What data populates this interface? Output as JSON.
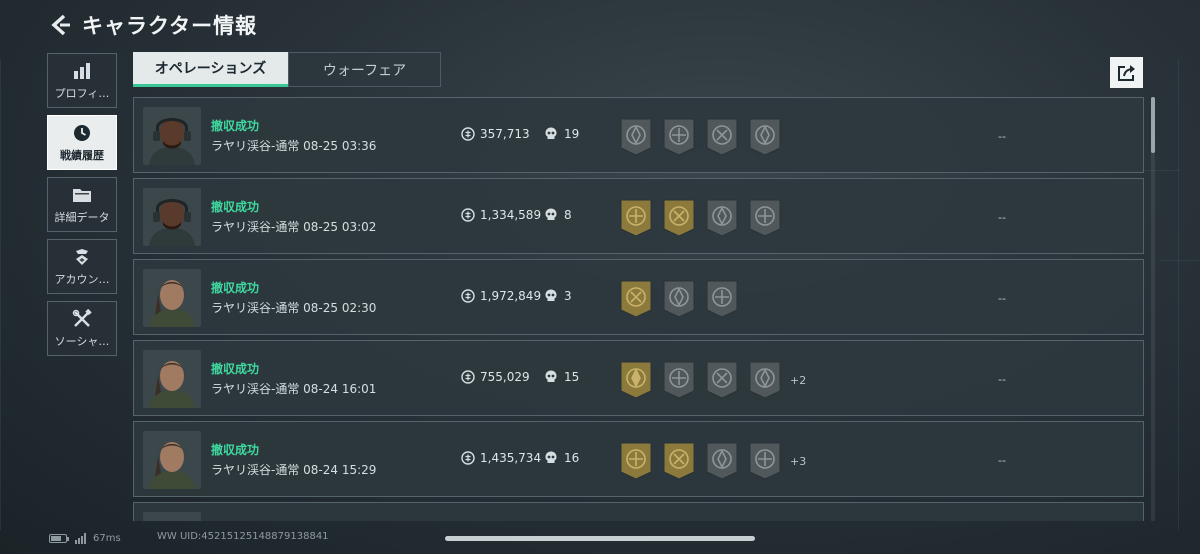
{
  "header": {
    "title": "キャラクター情報"
  },
  "sidebar": {
    "items": [
      {
        "label": "プロフィ…",
        "icon": "bar-chart-icon",
        "active": false
      },
      {
        "label": "戦績履歴",
        "icon": "history-clock-icon",
        "active": true
      },
      {
        "label": "詳細データ",
        "icon": "folder-icon",
        "active": false
      },
      {
        "label": "アカウン…",
        "icon": "account-badge-icon",
        "active": false
      },
      {
        "label": "ソーシャ…",
        "icon": "tools-icon",
        "active": false
      }
    ]
  },
  "tabs": [
    {
      "label": "オペレーションズ",
      "active": true
    },
    {
      "label": "ウォーフェア",
      "active": false
    }
  ],
  "share": {
    "icon": "share-export-icon"
  },
  "records": [
    {
      "result": "撤収成功",
      "detail": "ラヤリ渓谷-通常 08-25 03:36",
      "value": "357,713",
      "kills": "19",
      "more": "",
      "dash": "--",
      "avatar": "operator-male",
      "badges": [
        "grey",
        "grey",
        "grey",
        "grey"
      ]
    },
    {
      "result": "撤収成功",
      "detail": "ラヤリ渓谷-通常 08-25 03:02",
      "value": "1,334,589",
      "kills": "8",
      "more": "",
      "dash": "--",
      "avatar": "operator-male",
      "badges": [
        "gold",
        "gold",
        "grey",
        "grey"
      ]
    },
    {
      "result": "撤収成功",
      "detail": "ラヤリ渓谷-通常 08-25 02:30",
      "value": "1,972,849",
      "kills": "3",
      "more": "",
      "dash": "--",
      "avatar": "operator-female",
      "badges": [
        "gold",
        "grey",
        "grey"
      ]
    },
    {
      "result": "撤収成功",
      "detail": "ラヤリ渓谷-通常 08-24 16:01",
      "value": "755,029",
      "kills": "15",
      "more": "+2",
      "dash": "--",
      "avatar": "operator-female",
      "badges": [
        "gold",
        "grey",
        "grey",
        "grey"
      ]
    },
    {
      "result": "撤収成功",
      "detail": "ラヤリ渓谷-通常 08-24 15:29",
      "value": "1,435,734",
      "kills": "16",
      "more": "+3",
      "dash": "--",
      "avatar": "operator-female",
      "badges": [
        "gold",
        "gold",
        "grey",
        "grey"
      ]
    }
  ],
  "footer": {
    "ping": "67ms",
    "uid": "WW UID:452151251488791388​41"
  },
  "colors": {
    "accent_green": "#3fd89e",
    "badge_gold": "#8b7a3c",
    "badge_grey": "#50585c"
  }
}
